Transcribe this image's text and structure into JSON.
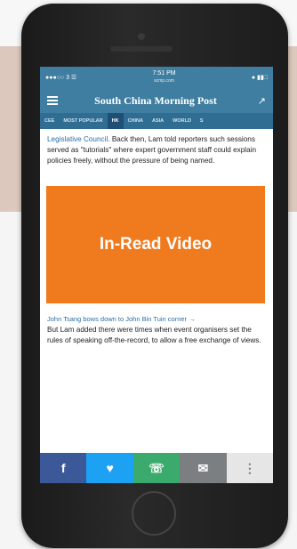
{
  "status_bar": {
    "carrier": "●●●○○ 3 ☰",
    "time": "7:51 PM",
    "url": "scmp.com",
    "battery": "● ▮▮□"
  },
  "app_bar": {
    "brand": "South China Morning Post",
    "menu_icon": "menu-icon",
    "trend_icon": "trend-icon"
  },
  "tabs": [
    {
      "label": "CEE"
    },
    {
      "label": "MOST POPULAR"
    },
    {
      "label": "HK"
    },
    {
      "label": "CHINA"
    },
    {
      "label": "ASIA"
    },
    {
      "label": "WORLD"
    },
    {
      "label": "S"
    }
  ],
  "article": {
    "para1_link": "Legislative Council",
    "para1_rest": ". Back then, Lam told reporters such sessions served as \"tutorials\" where expert government staff could explain policies freely, without the pressure of being named.",
    "video_label": "In-Read Video",
    "related": "John Tsang bows down to John Bin Tuin corner →",
    "para2": "But Lam added there were times when event organisers set the rules of speaking off-the-record, to allow a free exchange of views."
  },
  "share_bar": {
    "facebook": "f",
    "twitter": "♥",
    "whatsapp": "☏",
    "mail": "✉",
    "more": "⋮"
  }
}
